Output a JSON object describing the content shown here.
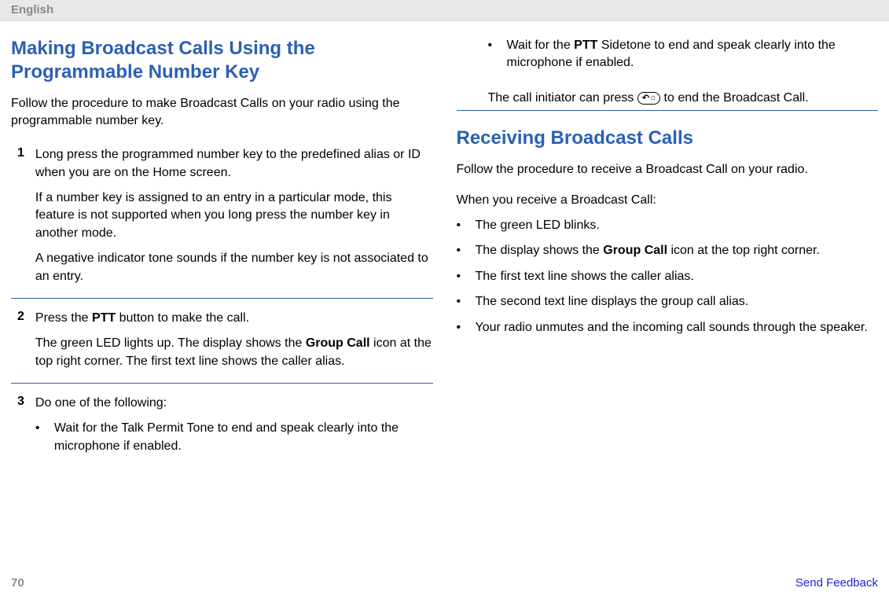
{
  "header": {
    "language": "English"
  },
  "left": {
    "heading": "Making Broadcast Calls Using the Programmable Number Key",
    "intro": "Follow the procedure to make Broadcast Calls on your radio using the programmable number key.",
    "steps": {
      "s1": {
        "num": "1",
        "p1": "Long press the programmed number key to the predefined alias or ID when you are on the Home screen.",
        "p2": "If a number key is assigned to an entry in a particular mode, this feature is not supported when you long press the number key in another mode.",
        "p3": "A negative indicator tone sounds if the number key is not associated to an entry."
      },
      "s2": {
        "num": "2",
        "p1a": "Press the ",
        "p1b": "PTT",
        "p1c": " button to make the call.",
        "p2a": "The green LED lights up. The display shows the ",
        "p2b": "Group Call",
        "p2c": " icon at the top right corner. The first text line shows the caller alias."
      },
      "s3": {
        "num": "3",
        "p1": "Do one of the following:",
        "b1": "Wait for the Talk Permit Tone to end and speak clearly into the microphone if enabled."
      }
    }
  },
  "right": {
    "top_bullet_a": "Wait for the ",
    "top_bullet_b": "PTT",
    "top_bullet_c": " Sidetone to end and speak clearly into the microphone if enabled.",
    "end_a": "The call initiator can press ",
    "end_b": " to end the Broadcast Call.",
    "heading": "Receiving Broadcast Calls",
    "intro": "Follow the procedure to receive a Broadcast Call on your radio.",
    "when": "When you receive a Broadcast Call:",
    "bullets": {
      "b1": "The green LED blinks.",
      "b2a": "The display shows the ",
      "b2b": "Group Call",
      "b2c": " icon at the top right corner.",
      "b3": "The first text line shows the caller alias.",
      "b4": "The second text line displays the group call alias.",
      "b5": "Your radio unmutes and the incoming call sounds through the speaker."
    }
  },
  "footer": {
    "page": "70",
    "feedback": "Send Feedback"
  }
}
